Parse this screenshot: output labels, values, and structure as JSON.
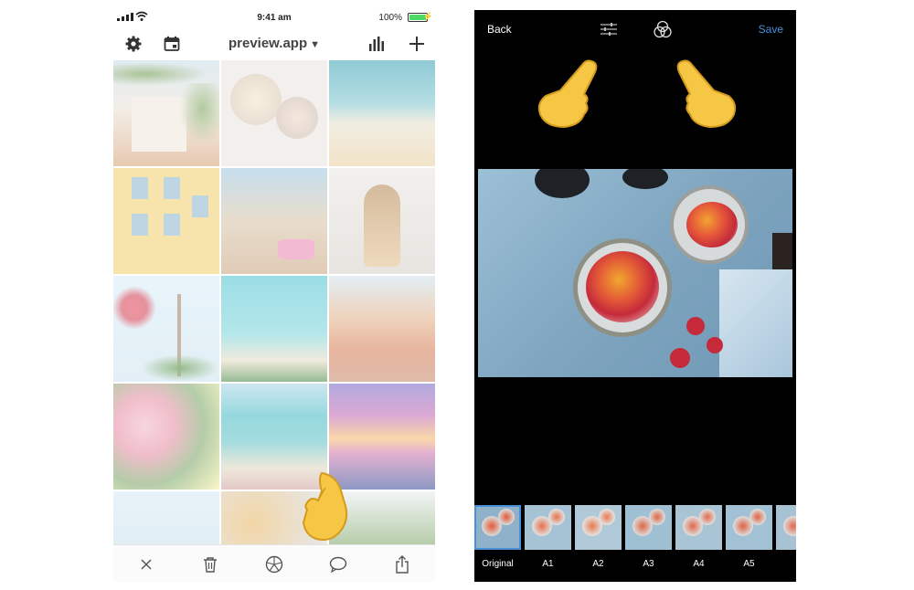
{
  "left_phone": {
    "status_bar": {
      "time": "9:41 am",
      "battery_percent": "100%",
      "battery_level": 1.0
    },
    "header": {
      "title": "preview.app",
      "icons": [
        "gear-icon",
        "calendar-icon",
        "chevron-down-icon",
        "bar-chart-icon",
        "plus-icon"
      ]
    },
    "grid_tiles": [
      "palm-buildings",
      "breakfast-bowls",
      "beach-waves",
      "yellow-facade",
      "havana-street",
      "woman-hair",
      "eiffel-tower",
      "turquoise-beach",
      "coastal-town",
      "flower-market",
      "beach-umbrellas",
      "purple-sunset",
      "sea-cliff",
      "food-platter",
      "palm-leaves"
    ],
    "bottom_toolbar": {
      "icons": [
        "close-icon",
        "trash-icon",
        "filter-wheel-icon",
        "comment-icon",
        "share-icon"
      ]
    }
  },
  "right_phone": {
    "header": {
      "back_label": "Back",
      "save_label": "Save",
      "icons": [
        "sliders-icon",
        "filters-circles-icon"
      ]
    },
    "filters": [
      "Original",
      "A1",
      "A2",
      "A3",
      "A4",
      "A5"
    ],
    "selected_filter": "Original"
  },
  "colors": {
    "accent": "#4a90d9",
    "battery_green": "#4cd964",
    "editor_background": "#000000"
  }
}
